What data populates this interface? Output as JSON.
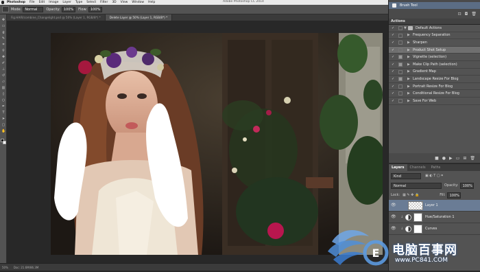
{
  "menubar": {
    "app_name": "Photoshop",
    "menus": [
      "File",
      "Edit",
      "Image",
      "Layer",
      "Type",
      "Select",
      "Filter",
      "3D",
      "View",
      "Window",
      "Help"
    ],
    "window_title": "Adobe Photoshop CC 2014"
  },
  "options": {
    "mode_label": "Mode:",
    "mode_value": "Normal",
    "opacity_label": "Opacity:",
    "opacity_value": "100%",
    "flow_label": "Flow:",
    "flow_value": "100%"
  },
  "tabs": [
    {
      "label": "Fig.HAIR/combine_Changelight.psd @ 50% (Layer 1, RGB/8*) *"
    },
    {
      "label": "Delete Layer @ 50% (Layer 1, RGB/8*) *"
    }
  ],
  "history": {
    "item_label": "Brush Tool"
  },
  "actions": {
    "title": "Actions",
    "items": [
      {
        "label": "Default Actions",
        "type": "set",
        "dialog": false
      },
      {
        "label": "Frequency Separation",
        "type": "action",
        "dialog": false
      },
      {
        "label": "Sharpen",
        "type": "action",
        "dialog": false
      },
      {
        "label": "Product Shot Setup",
        "type": "action",
        "dialog": false,
        "selected": true
      },
      {
        "label": "Vignette (selection)",
        "type": "action",
        "dialog": true
      },
      {
        "label": "Make Clip Path (selection)",
        "type": "action",
        "dialog": true
      },
      {
        "label": "Gradient Map",
        "type": "action",
        "dialog": false
      },
      {
        "label": "Landscape Resize For Blog",
        "type": "action",
        "dialog": true
      },
      {
        "label": "Portrait Resize For Blog",
        "type": "action",
        "dialog": false
      },
      {
        "label": "Conditional Resize For Blog",
        "type": "action",
        "dialog": false
      },
      {
        "label": "Save For Web",
        "type": "action",
        "dialog": false
      }
    ]
  },
  "layers_panel": {
    "tabs": [
      "Layers",
      "Channels",
      "Paths"
    ],
    "kind_label": "Kind",
    "blend_mode": "Normal",
    "opacity_label": "Opacity:",
    "opacity_value": "100%",
    "lock_label": "Lock:",
    "fill_label": "Fill:",
    "fill_value": "100%",
    "layers": [
      {
        "name": "Layer 1",
        "kind": "pixel",
        "selected": true
      },
      {
        "name": "Hue/Saturation 1",
        "kind": "adjustment"
      },
      {
        "name": "Curves",
        "kind": "adjustment"
      }
    ]
  },
  "statusbar": {
    "zoom": "50%",
    "doc": "Doc: 21.6M/86.3M"
  },
  "watermark": {
    "text": "电脑百事网",
    "url": "www.PC841.COM"
  }
}
